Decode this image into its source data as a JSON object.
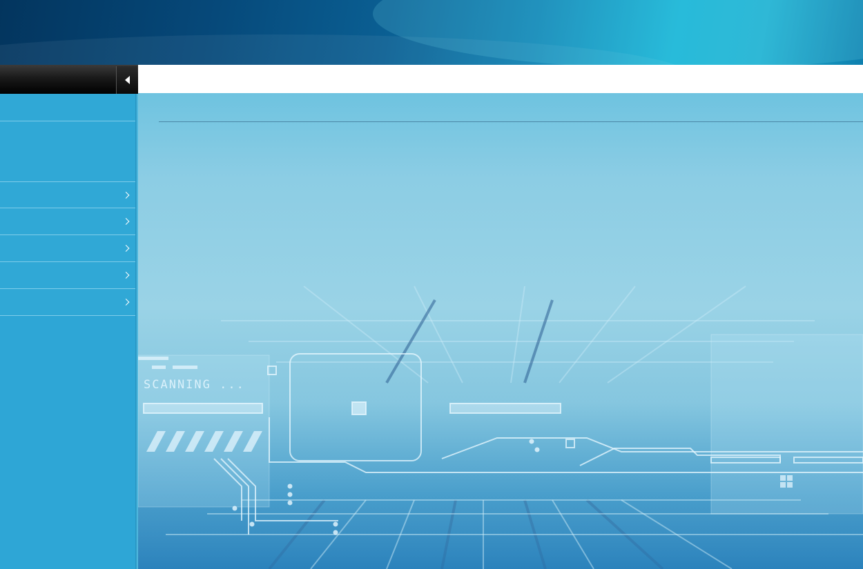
{
  "header": {
    "title": ""
  },
  "sidebar": {
    "top_label": "",
    "collapse_icon": "triangle-left-icon",
    "items": [
      {
        "label": "",
        "has_chevron": false
      },
      {
        "label": "",
        "has_chevron": false
      },
      {
        "label": "",
        "has_chevron": true
      },
      {
        "label": "",
        "has_chevron": true
      },
      {
        "label": "",
        "has_chevron": true
      },
      {
        "label": "",
        "has_chevron": true
      },
      {
        "label": "",
        "has_chevron": true
      }
    ]
  },
  "main": {
    "page_title": "",
    "background_text": "SCANNING ..."
  },
  "colors": {
    "sidebar": "#30a8d6",
    "header_dark": "#03355e",
    "header_light": "#16b4d6",
    "divider": "#7fcdea"
  }
}
